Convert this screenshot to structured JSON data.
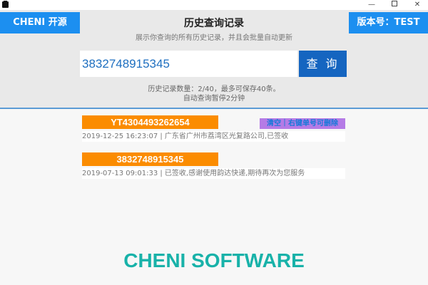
{
  "window": {
    "minimize_glyph": "—",
    "close_glyph": "✕"
  },
  "header": {
    "brand_label": "CHENI 开源",
    "version_label": "版本号：TEST",
    "title": "历史查询记录",
    "subtitle": "展示你查询的所有历史记录，并且会批量自动更新"
  },
  "search": {
    "value": "3832748915345",
    "button_label": "查 询"
  },
  "info": {
    "record_count": "历史记录数量：2/40，最多可保存40条。",
    "auto_pause": "自动查询暂停2分钟"
  },
  "clear_tip": "清空｜右键单号可删除",
  "records": [
    {
      "tracking_number": "YT4304493262654",
      "status": "2019-12-25 16:23:07 | 广东省广州市荔湾区光复路公司,已签收"
    },
    {
      "tracking_number": "3832748915345",
      "status": "2019-07-13 09:01:33 | 已签收,感谢使用韵达快递,期待再次为您服务"
    }
  ],
  "footer": {
    "brand": "CHENI SOFTWARE"
  },
  "colors": {
    "accent_blue": "#1c8ff0",
    "button_blue": "#1565c0",
    "tracking_orange": "#fb8c00",
    "footer_teal": "#18b2a9",
    "tip_purple": "#b57be6"
  }
}
